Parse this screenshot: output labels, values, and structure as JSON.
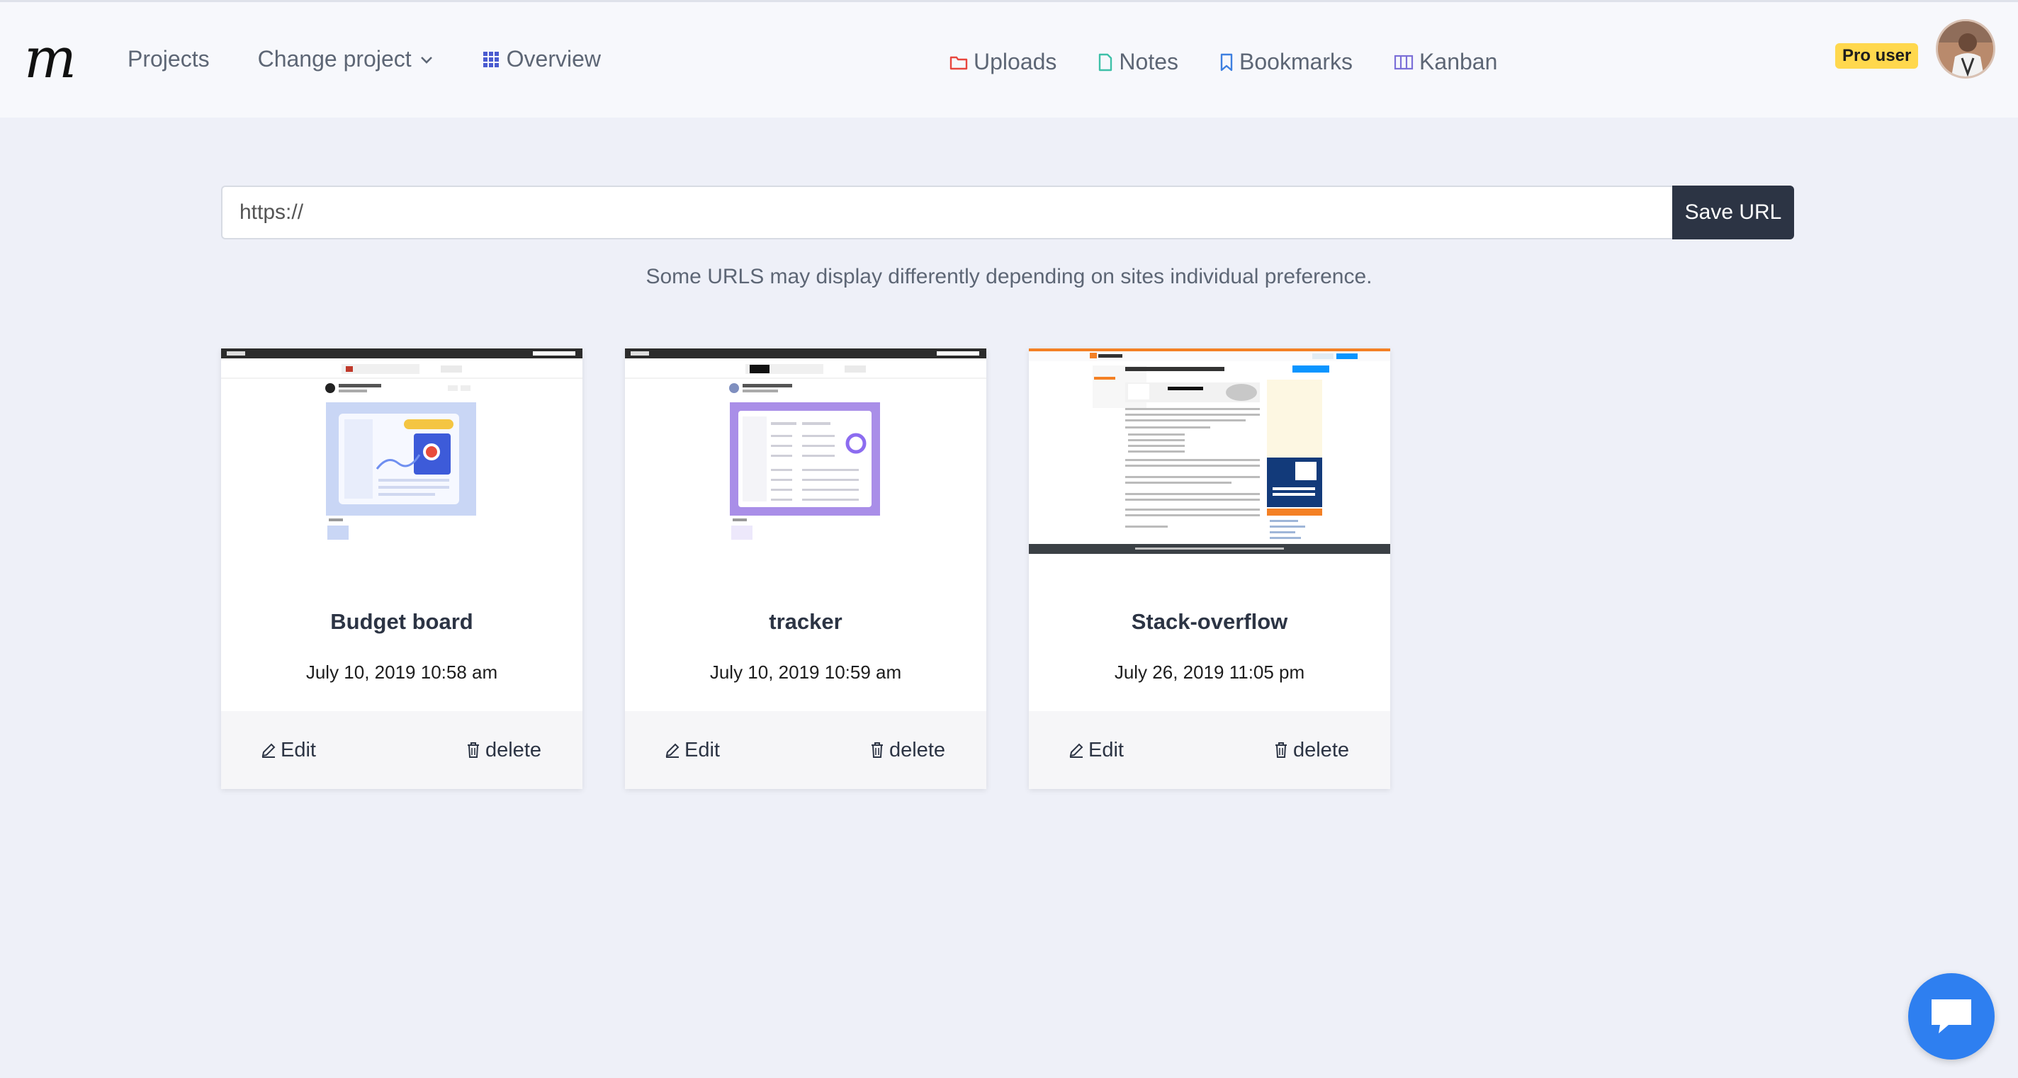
{
  "nav": {
    "logo": "m",
    "projects": "Projects",
    "change_project": "Change project",
    "overview": "Overview",
    "uploads": "Uploads",
    "notes": "Notes",
    "bookmarks": "Bookmarks",
    "kanban": "Kanban",
    "pro_badge": "Pro user"
  },
  "url_form": {
    "placeholder": "https://",
    "save_label": "Save URL",
    "note": "Some URLS may display differently depending on sites individual preference."
  },
  "cards": [
    {
      "title": "Budget board",
      "date": "July 10, 2019 10:58 am",
      "edit_label": "Edit",
      "delete_label": "delete"
    },
    {
      "title": "tracker",
      "date": "July 10, 2019 10:59 am",
      "edit_label": "Edit",
      "delete_label": "delete"
    },
    {
      "title": "Stack-overflow",
      "date": "July 26, 2019 11:05 pm",
      "edit_label": "Edit",
      "delete_label": "delete"
    }
  ],
  "colors": {
    "background": "#eef0f8",
    "topbar": "#f7f8fc",
    "dark_button": "#2c3444",
    "pro_badge": "#ffd84d",
    "uploads_icon": "#e8463e",
    "notes_icon": "#3ec0a8",
    "bookmarks_icon": "#3d7fe0",
    "kanban_icon": "#7b6fd8",
    "overview_icon": "#4a5bd0",
    "chat_button": "#2e7ff0"
  },
  "icons": {
    "uploads": "folder-icon",
    "notes": "document-icon",
    "bookmarks": "bookmark-icon",
    "kanban": "columns-icon",
    "overview": "grid-icon",
    "change_project": "chevron-down-icon",
    "edit": "pencil-icon",
    "delete": "trash-icon",
    "chat": "chat-bubble-icon"
  }
}
